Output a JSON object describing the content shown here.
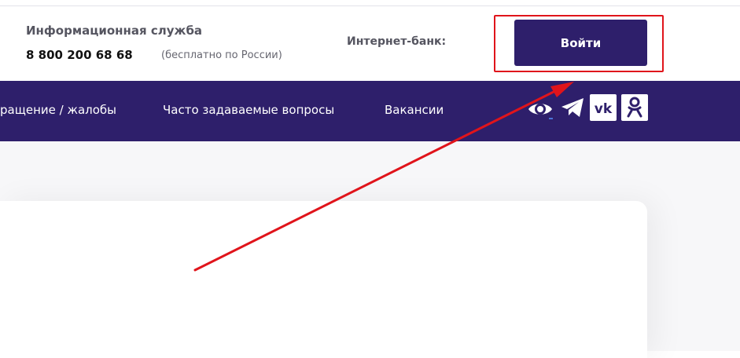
{
  "header": {
    "info_title": "Информационная служба",
    "phone": "8 800 200 68 68",
    "phone_note": "(бесплатно по России)",
    "internet_bank_label": "Интернет-банк:",
    "login_label": "Войти"
  },
  "nav": {
    "items": [
      "ращение / жалобы",
      "Часто задаваемые вопросы",
      "Вакансии"
    ],
    "icons": [
      "eye-icon",
      "telegram-icon",
      "vk-icon",
      "odnoklassniki-icon"
    ]
  },
  "colors": {
    "brand": "#2e1f6b",
    "highlight": "#e0141b"
  }
}
